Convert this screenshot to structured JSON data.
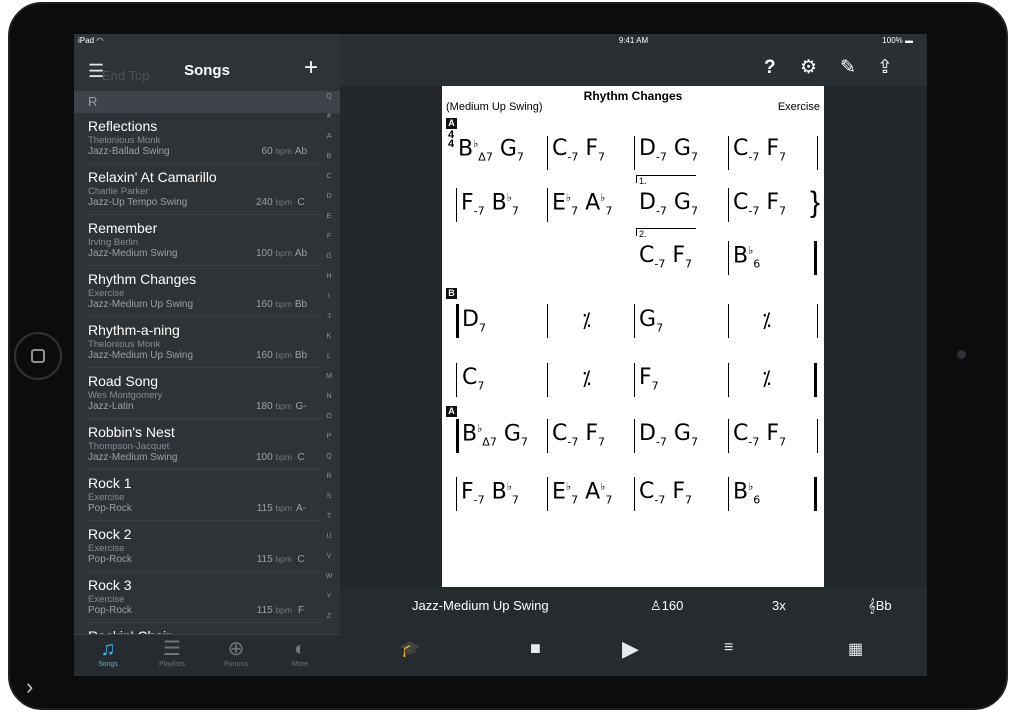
{
  "status": {
    "device": "iPad",
    "time": "9:41 AM",
    "battery": "100%"
  },
  "sidebar": {
    "title": "Songs",
    "ghost_text": "End Top",
    "section": "R",
    "songs": [
      {
        "title": "Reflections",
        "composer": "Thelonious Monk",
        "style": "Jazz-Ballad Swing",
        "bpm": "60",
        "key": "Ab"
      },
      {
        "title": "Relaxin' At Camarillo",
        "composer": "Charlie Parker",
        "style": "Jazz-Up Tempo Swing",
        "bpm": "240",
        "key": "C"
      },
      {
        "title": "Remember",
        "composer": "Irving Berlin",
        "style": "Jazz-Medium Swing",
        "bpm": "100",
        "key": "Ab"
      },
      {
        "title": "Rhythm Changes",
        "composer": "Exercise",
        "style": "Jazz-Medium Up Swing",
        "bpm": "160",
        "key": "Bb"
      },
      {
        "title": "Rhythm-a-ning",
        "composer": "Thelonious Monk",
        "style": "Jazz-Medium Up Swing",
        "bpm": "160",
        "key": "Bb"
      },
      {
        "title": "Road Song",
        "composer": "Wes Montgomery",
        "style": "Jazz-Latin",
        "bpm": "180",
        "key": "G-"
      },
      {
        "title": "Robbin's Nest",
        "composer": "Thompson-Jacquet",
        "style": "Jazz-Medium Swing",
        "bpm": "100",
        "key": "C"
      },
      {
        "title": "Rock 1",
        "composer": "Exercise",
        "style": "Pop-Rock",
        "bpm": "115",
        "key": "A-"
      },
      {
        "title": "Rock 2",
        "composer": "Exercise",
        "style": "Pop-Rock",
        "bpm": "115",
        "key": "C"
      },
      {
        "title": "Rock 3",
        "composer": "Exercise",
        "style": "Pop-Rock",
        "bpm": "115",
        "key": "F"
      },
      {
        "title": "Rockin' Chair",
        "composer": "",
        "style": "",
        "bpm": "",
        "key": ""
      }
    ],
    "bpm_unit": "bpm",
    "index": [
      "Q",
      "#",
      "A",
      "B",
      "C",
      "D",
      "E",
      "F",
      "G",
      "H",
      "I",
      "J",
      "K",
      "L",
      "M",
      "N",
      "O",
      "P",
      "Q",
      "R",
      "S",
      "T",
      "U",
      "V",
      "W",
      "Y",
      "Z"
    ],
    "tabs": [
      {
        "label": "Songs",
        "icon": "music-note-icon"
      },
      {
        "label": "Playlists",
        "icon": "list-icon"
      },
      {
        "label": "Forums",
        "icon": "globe-icon"
      },
      {
        "label": "More",
        "icon": "more-icon"
      }
    ]
  },
  "sheet": {
    "title": "Rhythm Changes",
    "style": "(Medium Up Swing)",
    "composer": "Exercise",
    "time_sig": [
      "4",
      "4"
    ],
    "rehearsal": [
      "A",
      "B",
      "A"
    ],
    "endings": [
      "1.",
      "2."
    ]
  },
  "player": {
    "style": "Jazz-Medium Up Swing",
    "tempo": "160",
    "repeats": "3x",
    "key": "Bb"
  },
  "colors": {
    "accent": "#3bb3e8",
    "panel": "#2e3337",
    "sheet": "#ffffff"
  }
}
